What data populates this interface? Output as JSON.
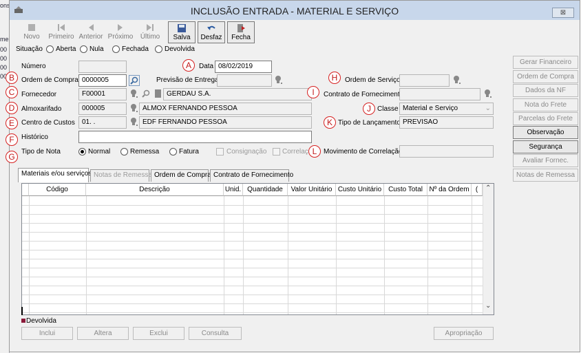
{
  "background_left": [
    "ons",
    "me",
    "00",
    "00",
    "00",
    "00"
  ],
  "window": {
    "title": "INCLUSÃO ENTRADA - MATERIAL E SERVIÇO",
    "close_glyph": "⊠"
  },
  "toolbar": {
    "novo": "Novo",
    "primeiro": "Primeiro",
    "anterior": "Anterior",
    "proximo": "Próximo",
    "ultimo": "Último",
    "salva": "Salva",
    "desfaz": "Desfaz",
    "fecha": "Fecha"
  },
  "situacao": {
    "label": "Situação",
    "options": [
      "Aberta",
      "Nula",
      "Fechada",
      "Devolvida"
    ]
  },
  "form": {
    "numero_label": "Número",
    "numero": "",
    "data_label": "Data",
    "data": "08/02/2019",
    "ordem_compra_label": "Ordem de Compra",
    "ordem_compra": "0000005",
    "previsao_label": "Previsão de Entrega",
    "previsao": "",
    "ordem_servico_label": "Ordem de Serviço",
    "ordem_servico": "",
    "fornecedor_label": "Fornecedor",
    "fornecedor_code": "F00001",
    "fornecedor_name": "GERDAU S.A.",
    "contrato_label": "Contrato de Fornecimento",
    "contrato": "",
    "almox_label": "Almoxarifado",
    "almox_code": "000005",
    "almox_name": "ALMOX FERNANDO PESSOA",
    "classe_label": "Classe",
    "classe": "Material e Serviço",
    "centro_label": "Centro de Custos",
    "centro_code": "01.   .",
    "centro_name": "EDF FERNANDO PESSOA",
    "tipo_lanc_label": "Tipo de Lançamento",
    "tipo_lanc": "PREVISAO",
    "historico_label": "Histórico",
    "historico": "",
    "tipo_nota_label": "Tipo de Nota",
    "tipo_nota_options": [
      "Normal",
      "Remessa",
      "Fatura"
    ],
    "consignacao": "Consignação",
    "correlacao": "Correlação",
    "movimento_label": "Movimento de Correlação",
    "movimento": ""
  },
  "markers": [
    "A",
    "B",
    "C",
    "D",
    "E",
    "F",
    "G",
    "H",
    "I",
    "J",
    "K",
    "L"
  ],
  "side_buttons": [
    {
      "label": "Gerar Financeiro",
      "enabled": false
    },
    {
      "label": "Ordem de Compra",
      "enabled": false
    },
    {
      "label": "Dados da NF",
      "enabled": false
    },
    {
      "label": "Nota do Frete",
      "enabled": false
    },
    {
      "label": "Parcelas do Frete",
      "enabled": false
    },
    {
      "label": "Observação",
      "enabled": true
    },
    {
      "label": "Segurança",
      "enabled": true
    },
    {
      "label": "Avaliar Fornec.",
      "enabled": false
    },
    {
      "label": "Notas de Remessa",
      "enabled": false
    }
  ],
  "tabs": [
    "Materiais e/ou serviços",
    "Notas de Remessa",
    "Ordem de Compra",
    "Contrato de Fornecimento"
  ],
  "grid": {
    "columns": [
      "Código",
      "Descrição",
      "Unid.",
      "Quantidade",
      "Valor Unitário",
      "Custo Unitário",
      "Custo Total",
      "Nº da Ordem",
      "("
    ],
    "rows": []
  },
  "legend": "Devolvida",
  "bottom_buttons": [
    "Inclui",
    "Altera",
    "Exclui",
    "Consulta",
    "Apropriação"
  ],
  "colors": {
    "marker": "#d62020",
    "titlebar": "#c8d7eb",
    "legend_square": "#8b1a3a"
  }
}
